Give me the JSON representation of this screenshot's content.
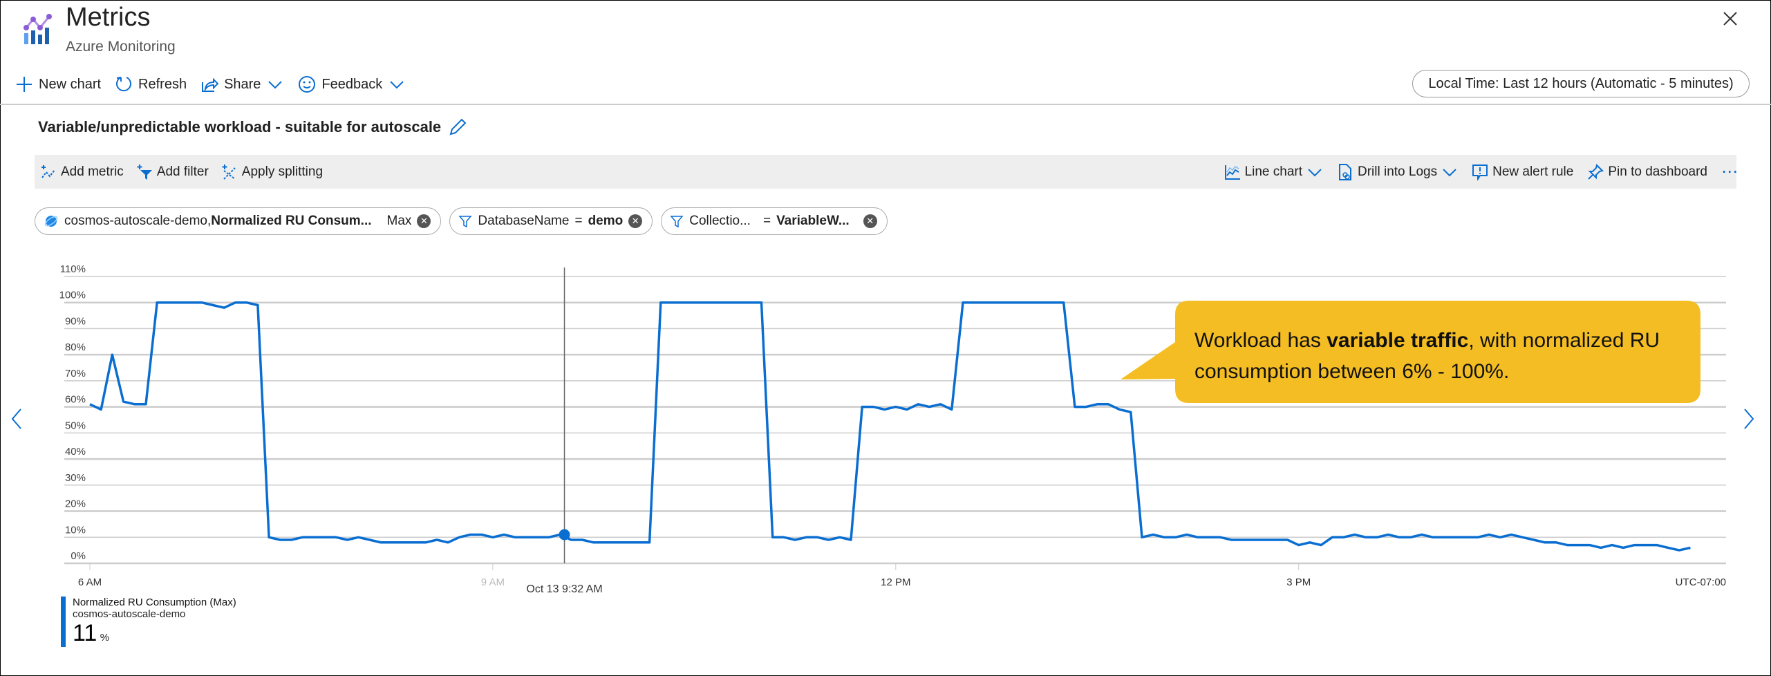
{
  "header": {
    "title": "Metrics",
    "subtitle": "Azure Monitoring"
  },
  "commands": [
    {
      "label": "New chart",
      "icon": "plus-icon"
    },
    {
      "label": "Refresh",
      "icon": "refresh-icon"
    },
    {
      "label": "Share",
      "icon": "share-icon"
    },
    {
      "label": "Feedback",
      "icon": "smiley-icon"
    }
  ],
  "time_range": "Local Time: Last 12 hours (Automatic - 5 minutes)",
  "chart_title": "Variable/unpredictable workload - suitable for autoscale",
  "toolbar": {
    "add_metric": "Add metric",
    "add_filter": "Add filter",
    "apply_splitting": "Apply splitting",
    "line_chart": "Line chart",
    "drill_logs": "Drill into Logs",
    "new_alert": "New alert rule",
    "pin": "Pin to dashboard",
    "more": "⋯"
  },
  "pills": {
    "metric": {
      "resource": "cosmos-autoscale-demo,",
      "metric": "Normalized RU Consum...",
      "agg": "Max"
    },
    "filter1": {
      "key": "DatabaseName",
      "op": "=",
      "value": "demo"
    },
    "filter2": {
      "key": "Collectio...",
      "op": "=",
      "value": "VariableW..."
    }
  },
  "callout": {
    "pre": "Workload has ",
    "bold": "variable traffic",
    "post": ", with normalized RU consumption between 6% - 100%.",
    "color": "#f4bd23"
  },
  "legend": {
    "metric": "Normalized RU Consumption (Max)",
    "resource": "cosmos-autoscale-demo",
    "value": "11",
    "unit": "%"
  },
  "colors": {
    "series": "#0a6ed1",
    "accent": "#0a6ed1",
    "grid": "#cccccc"
  },
  "chart_data": {
    "type": "line",
    "ylim": [
      0,
      110
    ],
    "yticks": [
      "0%",
      "10%",
      "20%",
      "30%",
      "40%",
      "50%",
      "60%",
      "70%",
      "80%",
      "90%",
      "100%",
      "110%"
    ],
    "xticks": [
      {
        "label": "6 AM",
        "time": "06:00"
      },
      {
        "label": "9 AM",
        "time": "09:00"
      },
      {
        "label": "12 PM",
        "time": "12:00"
      },
      {
        "label": "3 PM",
        "time": "15:00"
      }
    ],
    "timezone_label": "UTC-07:00",
    "cursor": {
      "label": "Oct 13 9:32 AM",
      "time": "09:32",
      "value": 11
    },
    "grid": true,
    "x_range": [
      "06:00",
      "18:00"
    ],
    "series": [
      {
        "name": "Normalized RU Consumption (Max)",
        "x_start": "06:00",
        "x_step_minutes": 5,
        "values": [
          61,
          59,
          80,
          62,
          61,
          61,
          100,
          100,
          100,
          100,
          100,
          99,
          98,
          100,
          100,
          99,
          10,
          9,
          9,
          10,
          10,
          10,
          10,
          9,
          10,
          9,
          8,
          8,
          8,
          8,
          8,
          9,
          8,
          10,
          11,
          11,
          10,
          11,
          10,
          10,
          10,
          10,
          11,
          9,
          9,
          8,
          8,
          8,
          8,
          8,
          8,
          100,
          100,
          100,
          100,
          100,
          100,
          100,
          100,
          100,
          100,
          10,
          10,
          9,
          10,
          10,
          9,
          10,
          9,
          60,
          60,
          59,
          60,
          59,
          61,
          60,
          61,
          59,
          100,
          100,
          100,
          100,
          100,
          100,
          100,
          100,
          100,
          100,
          60,
          60,
          61,
          61,
          59,
          58,
          10,
          11,
          10,
          10,
          11,
          10,
          10,
          10,
          9,
          9,
          9,
          9,
          9,
          9,
          7,
          8,
          7,
          10,
          10,
          11,
          10,
          10,
          11,
          10,
          10,
          11,
          10,
          10,
          10,
          10,
          10,
          11,
          10,
          11,
          10,
          9,
          8,
          8,
          7,
          7,
          7,
          6,
          7,
          6,
          7,
          7,
          7,
          6,
          5,
          6
        ]
      }
    ]
  }
}
